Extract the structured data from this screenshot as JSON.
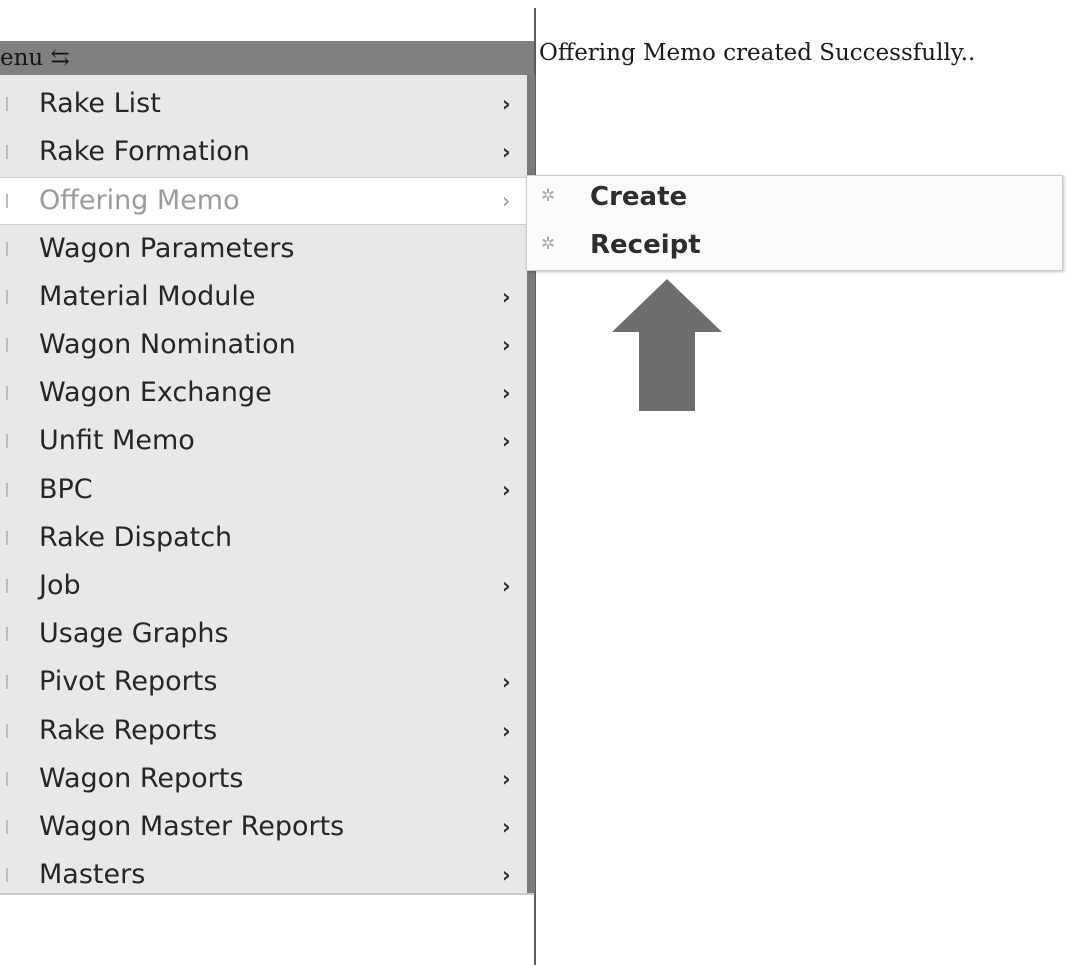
{
  "menu": {
    "header_label": "enu ⇆",
    "items": [
      {
        "label": "Rake List",
        "has_submenu": true
      },
      {
        "label": "Rake Formation",
        "has_submenu": true
      },
      {
        "label": "Offering Memo",
        "has_submenu": true,
        "active": true
      },
      {
        "label": "Wagon Parameters",
        "has_submenu": false
      },
      {
        "label": "Material Module",
        "has_submenu": true
      },
      {
        "label": "Wagon Nomination",
        "has_submenu": true
      },
      {
        "label": "Wagon Exchange",
        "has_submenu": true
      },
      {
        "label": "Unfit Memo",
        "has_submenu": true
      },
      {
        "label": "BPC",
        "has_submenu": true
      },
      {
        "label": "Rake Dispatch",
        "has_submenu": false
      },
      {
        "label": "Job",
        "has_submenu": true
      },
      {
        "label": "Usage Graphs",
        "has_submenu": false
      },
      {
        "label": "Pivot Reports",
        "has_submenu": true
      },
      {
        "label": "Rake Reports",
        "has_submenu": true
      },
      {
        "label": "Wagon Reports",
        "has_submenu": true
      },
      {
        "label": "Wagon Master Reports",
        "has_submenu": true
      },
      {
        "label": "Masters",
        "has_submenu": true
      }
    ],
    "chevron_glyph": "›"
  },
  "submenu": {
    "parent": "Offering Memo",
    "items": [
      {
        "label": "Create",
        "icon": "gear-icon"
      },
      {
        "label": "Receipt",
        "icon": "gear-icon"
      }
    ],
    "gear_glyph": "✲"
  },
  "status": {
    "message": "Offering Memo created Successfully.."
  },
  "annotation": {
    "icon": "up-arrow-icon",
    "color": "#6e6e6e"
  },
  "colors": {
    "menu_bg": "#e8e8e8",
    "menu_header_bg": "#808080",
    "active_item_text": "#9b9b9b"
  }
}
